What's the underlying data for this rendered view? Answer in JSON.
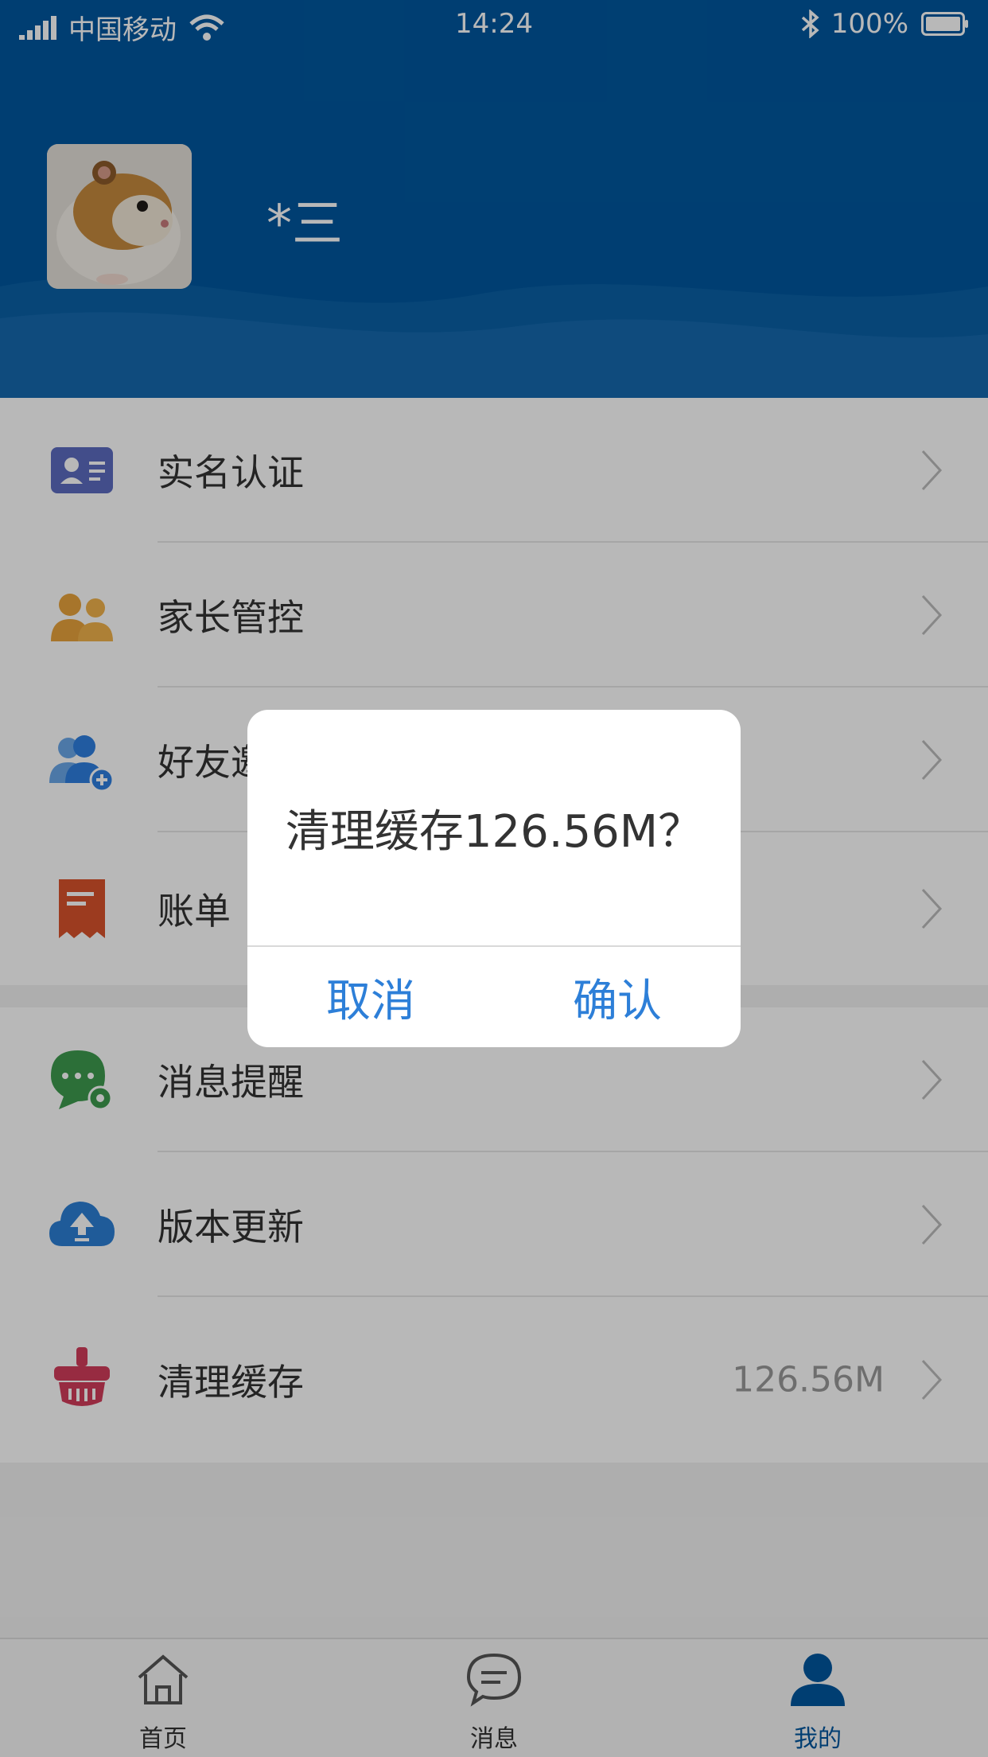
{
  "status_bar": {
    "carrier": "中国移动",
    "time": "14:24",
    "battery": "100%"
  },
  "profile": {
    "username": "*三"
  },
  "menu": {
    "group1": [
      {
        "label": "实名认证",
        "icon": "id-card-icon"
      },
      {
        "label": "家长管控",
        "icon": "parents-icon"
      },
      {
        "label": "好友邀请",
        "icon": "add-friend-icon"
      },
      {
        "label": "账单",
        "icon": "bill-icon"
      }
    ],
    "group2": [
      {
        "label": "消息提醒",
        "icon": "message-settings-icon"
      },
      {
        "label": "版本更新",
        "icon": "cloud-upload-icon"
      },
      {
        "label": "清理缓存",
        "icon": "broom-icon",
        "value": "126.56M"
      }
    ]
  },
  "tabs": [
    {
      "label": "首页",
      "icon": "home-icon"
    },
    {
      "label": "消息",
      "icon": "chat-icon"
    },
    {
      "label": "我的",
      "icon": "user-icon",
      "active": true
    }
  ],
  "dialog": {
    "message": "清理缓存126.56M？",
    "cancel": "取消",
    "confirm": "确认"
  },
  "colors": {
    "header": "#00579e",
    "accent": "#2d7fd8"
  }
}
